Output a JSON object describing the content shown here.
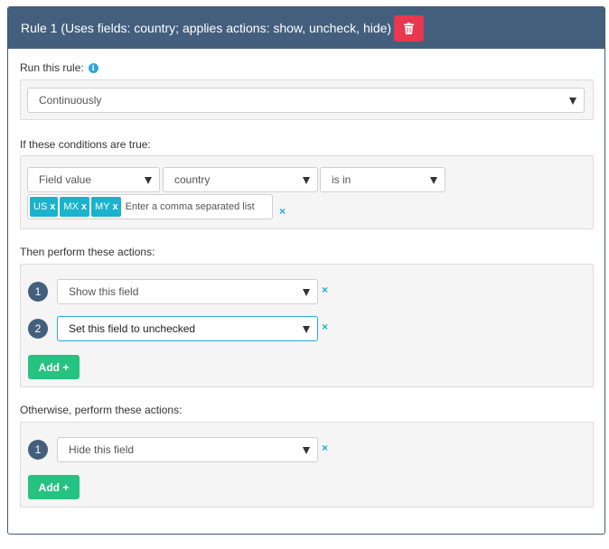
{
  "rule": {
    "title": "Rule 1 (Uses fields: country; applies actions: show, uncheck, hide)",
    "delete_icon": "trash-icon"
  },
  "run": {
    "label": "Run this rule:",
    "info_icon": "i",
    "value": "Continuously"
  },
  "conditions": {
    "label": "If these conditions are true:",
    "type_value": "Field value",
    "field_value": "country",
    "operator_value": "is in",
    "tags": [
      "US",
      "MX",
      "MY"
    ],
    "tag_remove": "x",
    "input_placeholder": "Enter a comma separated list",
    "remove": "×"
  },
  "then_actions": {
    "label": "Then perform these actions:",
    "items": [
      {
        "number": "1",
        "value": "Show this field",
        "remove": "×"
      },
      {
        "number": "2",
        "value": "Set this field to unchecked",
        "remove": "×"
      }
    ],
    "add_label": "Add +"
  },
  "else_actions": {
    "label": "Otherwise, perform these actions:",
    "items": [
      {
        "number": "1",
        "value": "Hide this field",
        "remove": "×"
      }
    ],
    "add_label": "Add +"
  },
  "colors": {
    "header": "#445f7d",
    "delete": "#e8384f",
    "tag": "#1ab2cc",
    "add": "#26c281",
    "focus": "#2ea6d9"
  }
}
